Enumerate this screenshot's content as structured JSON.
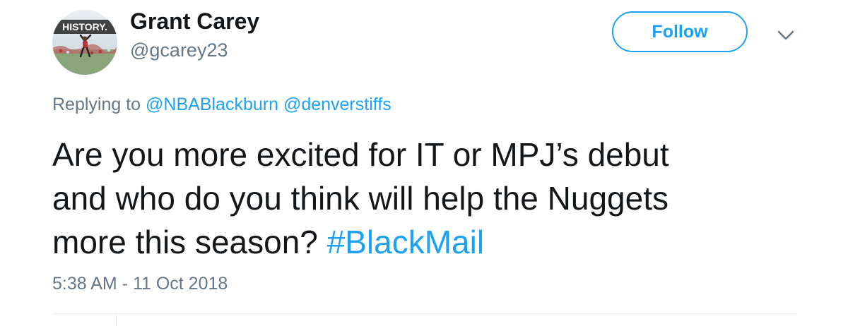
{
  "tweet": {
    "author": {
      "display_name": "Grant Carey",
      "handle": "@gcarey23",
      "avatar_badge_text": "HISTORY."
    },
    "follow_label": "Follow",
    "menu_icon": "chevron-down-icon",
    "reply": {
      "prefix": "Replying to",
      "mentions": [
        "@NBABlackburn",
        "@denverstiffs"
      ]
    },
    "text": {
      "line1": "Are you more excited for IT or MPJ’s debut",
      "line2": "and who do you think will help the Nuggets",
      "line3": "more this season?",
      "hashtag": "#BlackMail"
    },
    "timestamp": "5:38 AM - 11 Oct 2018"
  },
  "colors": {
    "accent": "#1da1f2",
    "primary_text": "#14171a",
    "secondary_text": "#657786",
    "divider": "#e6ecf0"
  }
}
